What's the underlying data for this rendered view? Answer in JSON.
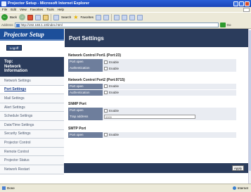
{
  "window": {
    "title": "Projector Setup - Microsoft Internet Explorer"
  },
  "menu": [
    "File",
    "Edit",
    "View",
    "Favorites",
    "Tools",
    "Help"
  ],
  "toolbar": {
    "back_label": "Back",
    "search_label": "Search",
    "favorites_label": "Favorites"
  },
  "address": {
    "label": "Address",
    "url": "http://192.168.1.10/index.html",
    "go_label": "Go"
  },
  "nav": {
    "brand": "Projector Setup",
    "logoff": "Logoff",
    "top_title_line1": "Top:",
    "top_title_line2": "Network",
    "top_title_line3": "Information",
    "items": [
      {
        "label": "Network Settings"
      },
      {
        "label": "Port Settings"
      },
      {
        "label": "Mail Settings"
      },
      {
        "label": "Alert Settings"
      },
      {
        "label": "Schedule Settings"
      },
      {
        "label": "Date/Time Settings"
      },
      {
        "label": "Security Settings"
      },
      {
        "label": "Projector Control"
      },
      {
        "label": "Remote Control"
      },
      {
        "label": "Projector Status"
      },
      {
        "label": "Network Restart"
      }
    ]
  },
  "main": {
    "title": "Port Settings",
    "sections": [
      {
        "title": "Network Control Port1 (Port:23)",
        "port_open_key": "Port open",
        "port_open_val": "Enable",
        "auth_key": "Authentication",
        "auth_val": "Enable"
      },
      {
        "title": "Network Control Port2 (Port:9715)",
        "port_open_key": "Port open",
        "port_open_val": "Enable",
        "auth_key": "Authentication",
        "auth_val": "Enable"
      },
      {
        "title": "SNMP Port",
        "port_open_key": "Port open",
        "port_open_val": "Enable",
        "trap_key": "Trap address",
        "trap_val": "0000"
      },
      {
        "title": "SMTP Port",
        "port_open_key": "Port open",
        "port_open_val": "Enable"
      }
    ],
    "apply_label": "Apply"
  },
  "status": {
    "left": "Done",
    "zone": "Internet"
  },
  "colors": {
    "nav_dark": "#2b3c5c",
    "brand_blue": "#1c4f9a",
    "row_key": "#6e7e9c"
  }
}
